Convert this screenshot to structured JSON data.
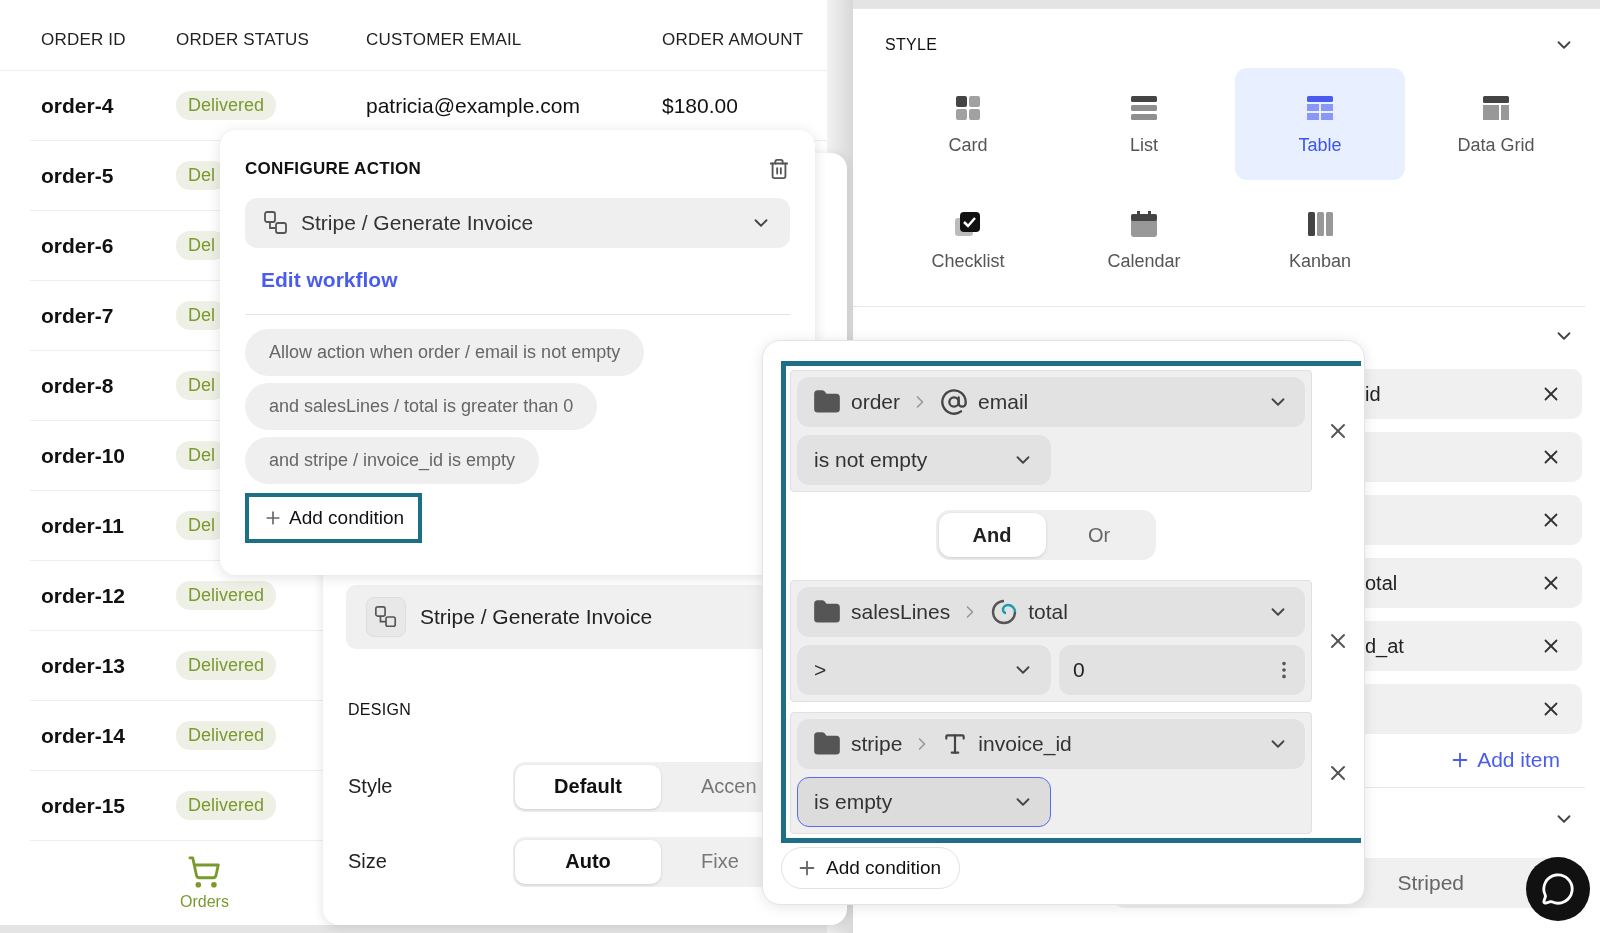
{
  "table": {
    "columns": [
      "ORDER ID",
      "ORDER STATUS",
      "CUSTOMER EMAIL",
      "ORDER AMOUNT"
    ],
    "rows": [
      {
        "order_id": "order-4",
        "status": "Delivered",
        "email": "patricia@example.com",
        "amount": "$180.00"
      },
      {
        "order_id": "order-5",
        "status": "Del"
      },
      {
        "order_id": "order-6",
        "status": "Del"
      },
      {
        "order_id": "order-7",
        "status": "Del"
      },
      {
        "order_id": "order-8",
        "status": "Del"
      },
      {
        "order_id": "order-10",
        "status": "Del"
      },
      {
        "order_id": "order-11",
        "status": "Del"
      },
      {
        "order_id": "order-12",
        "status": "Delivered"
      },
      {
        "order_id": "order-13",
        "status": "Delivered"
      },
      {
        "order_id": "order-14",
        "status": "Delivered"
      },
      {
        "order_id": "order-15",
        "status": "Delivered"
      }
    ]
  },
  "bottom_nav": [
    {
      "label": "Orders",
      "selected": true
    }
  ],
  "design_panel": {
    "action_item": "Stripe / Generate Invoice",
    "section_title": "DESIGN",
    "settings": [
      {
        "label": "Style",
        "options": [
          {
            "label": "Default",
            "selected": true
          },
          {
            "label": "Accen",
            "selected": false
          }
        ]
      },
      {
        "label": "Size",
        "options": [
          {
            "label": "Auto",
            "selected": true
          },
          {
            "label": "Fixe",
            "selected": false
          }
        ]
      }
    ]
  },
  "configure_action": {
    "title": "CONFIGURE ACTION",
    "action": "Stripe / Generate Invoice",
    "link": "Edit workflow",
    "conditions": [
      "Allow action when order / email is not empty",
      "and salesLines / total is greater than 0",
      "and stripe / invoice_id is empty"
    ],
    "add_button": "Add condition"
  },
  "condition_editor": {
    "groups": [
      {
        "source": "order",
        "field": "email",
        "kind": "email",
        "operator": "is not empty",
        "focused": false
      },
      {
        "source": "salesLines",
        "field": "total",
        "kind": "number",
        "operator": ">",
        "value": "0",
        "focused": false
      },
      {
        "source": "stripe",
        "field": "invoice_id",
        "kind": "text",
        "operator": "is empty",
        "focused": true
      }
    ],
    "joiner": [
      {
        "label": "And",
        "selected": true
      },
      {
        "label": "Or",
        "selected": false
      }
    ],
    "add_button": "Add condition"
  },
  "settings_panel": {
    "style_title": "STYLE",
    "views": [
      {
        "label": "Card",
        "kind": "card",
        "selected": false
      },
      {
        "label": "List",
        "kind": "list",
        "selected": false
      },
      {
        "label": "Table",
        "kind": "table",
        "selected": true
      },
      {
        "label": "Data Grid",
        "kind": "grid",
        "selected": false
      },
      {
        "label": "Checklist",
        "kind": "checklist",
        "selected": false
      },
      {
        "label": "Calendar",
        "kind": "calendar",
        "selected": false
      },
      {
        "label": "Kanban",
        "kind": "kanban",
        "selected": false
      }
    ],
    "column_items": [
      {
        "kind": "labeled",
        "label": "id"
      },
      {
        "kind": "covered"
      },
      {
        "kind": "covered"
      },
      {
        "kind": "labeled",
        "label": "otal"
      },
      {
        "kind": "labeled",
        "label": "d_at"
      },
      {
        "kind": "covered"
      }
    ],
    "add_item": "Add item",
    "appearance_options": [
      {
        "label": "Striped",
        "selected": false
      }
    ]
  }
}
